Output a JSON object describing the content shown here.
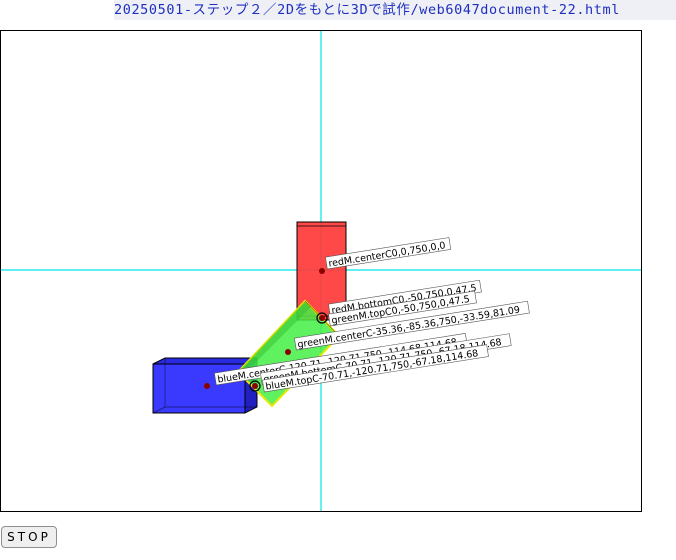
{
  "page": {
    "title": "20250501-ステップ２／2Dをもとに3Dで試作/web6047document-22.html"
  },
  "controls": {
    "stop_label": "STOP"
  },
  "colors": {
    "axis": "#00e5e5",
    "red": "#ff3a3a",
    "green": "#44ee44",
    "blue": "#3a3aff",
    "point": "#8b0000"
  },
  "labels": {
    "red_center": "redM.centerC0,0,750,0,0",
    "red_bottom": "redM.bottomC0,-50,750,0,47.5",
    "green_top": "greenM.topC0,-50,750,0,47.5",
    "green_center": "greenM.centerC-35.36,-85.36,750,-33.59,81.09",
    "blue_center": "blueM.centerC-120.71,-120.71,750,-114.68,114.68",
    "green_bottom": "greenM.bottomC-70.71,-120.71,750,-67.18,114.68",
    "blue_top": "blueM.topC-70.71,-120.71,750,-67.18,114.68"
  }
}
